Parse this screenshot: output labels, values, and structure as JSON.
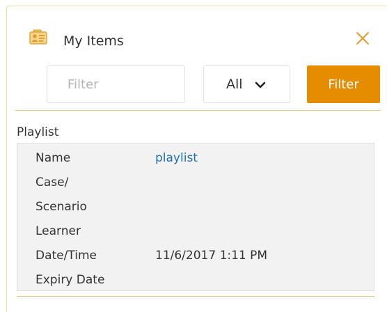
{
  "header": {
    "title": "My Items",
    "icon": "items-card-icon",
    "close_icon": "close-icon",
    "accent_color": "#e58c00"
  },
  "toolbar": {
    "filter_placeholder": "Filter",
    "filter_value": "",
    "select_value": "All",
    "filter_button_label": "Filter"
  },
  "section": {
    "label": "Playlist"
  },
  "record": {
    "rows": [
      {
        "label": "Name",
        "value": "playlist",
        "link": true
      },
      {
        "label": "Case/",
        "value": ""
      },
      {
        "label": "Scenario",
        "value": ""
      },
      {
        "label": "Learner",
        "value": ""
      },
      {
        "label": "Date/Time",
        "value": "11/6/2017 1:11 PM"
      },
      {
        "label": "Expiry Date",
        "value": ""
      }
    ]
  }
}
